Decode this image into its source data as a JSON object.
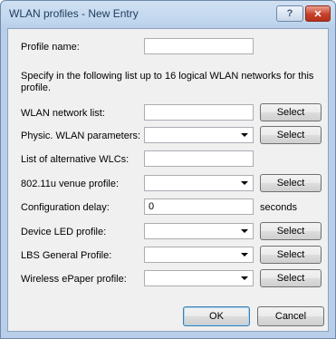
{
  "window": {
    "title": "WLAN profiles - New Entry",
    "help_label": "?",
    "close_label": "✕"
  },
  "form": {
    "profile_name_label": "Profile name:",
    "profile_name_value": "",
    "description": "Specify in the following list up to 16 logical WLAN networks for this profile.",
    "wlan_network_list_label": "WLAN network list:",
    "physic_wlan_label": "Physic. WLAN parameters:",
    "alt_wlcs_label": "List of alternative WLCs:",
    "venue_profile_label": "802.11u venue profile:",
    "config_delay_label": "Configuration delay:",
    "config_delay_value": "0",
    "config_delay_unit": "seconds",
    "device_led_label": "Device LED profile:",
    "lbs_general_label": "LBS General Profile:",
    "epaper_label": "Wireless ePaper profile:",
    "select_label": "Select"
  },
  "buttons": {
    "ok": "OK",
    "cancel": "Cancel"
  }
}
